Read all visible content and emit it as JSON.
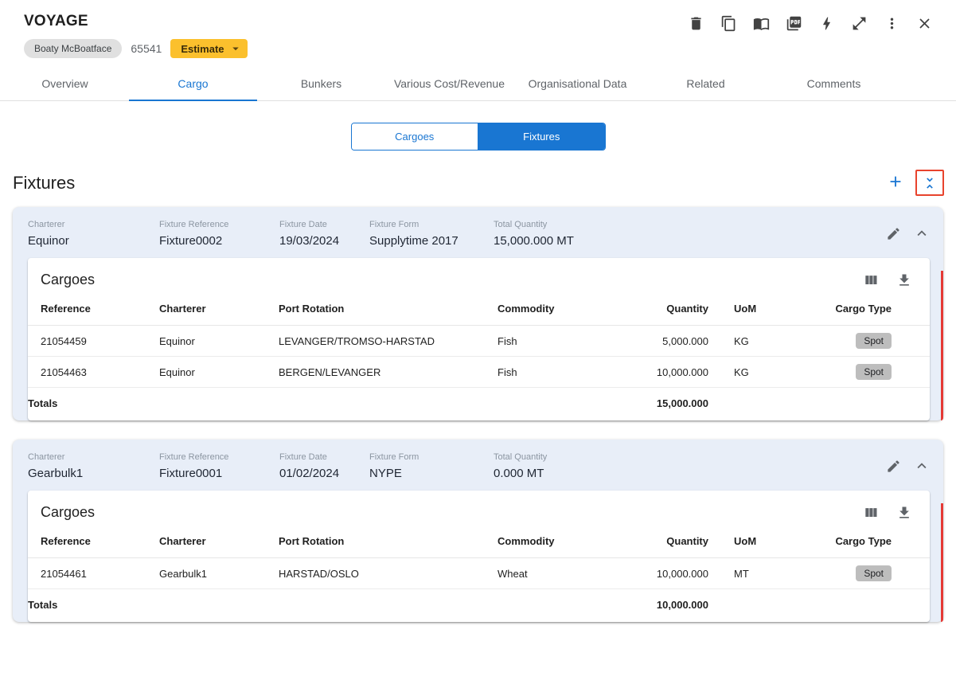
{
  "colors": {
    "primary_blue": "#1976d2",
    "estimate_amber": "#fbc02d",
    "fixture_header_bg": "#e8eef8",
    "red_accent": "#e53935",
    "focus_outline_red": "#e8432d",
    "chip_gray": "#bdbdbd"
  },
  "header": {
    "title": "VOYAGE",
    "vessel_name": "Boaty McBoatface",
    "voyage_number": "65541",
    "estimate_label": "Estimate"
  },
  "toolbar": {
    "icons": [
      "delete-icon",
      "copy-icon",
      "book-icon",
      "pdf-icon",
      "bolt-icon",
      "open-in-full-icon",
      "more-vert-icon",
      "close-icon"
    ]
  },
  "tabs": [
    "Overview",
    "Cargo",
    "Bunkers",
    "Various Cost/Revenue",
    "Organisational Data",
    "Related",
    "Comments"
  ],
  "active_tab": "Cargo",
  "view_toggle": {
    "cargoes": "Cargoes",
    "fixtures": "Fixtures",
    "selected": "Fixtures"
  },
  "fixtures_section": {
    "title": "Fixtures"
  },
  "fixtures": [
    {
      "charterer_label": "Charterer",
      "charterer": "Equinor",
      "reference_label": "Fixture Reference",
      "reference": "Fixture0002",
      "date_label": "Fixture Date",
      "date": "19/03/2024",
      "form_label": "Fixture Form",
      "form": "Supplytime 2017",
      "quantity_label": "Total Quantity",
      "quantity": "15,000.000 MT",
      "cargoes": {
        "title": "Cargoes",
        "columns": [
          "Reference",
          "Charterer",
          "Port Rotation",
          "Commodity",
          "Quantity",
          "UoM",
          "Cargo Type"
        ],
        "rows": [
          {
            "reference": "21054459",
            "charterer": "Equinor",
            "port_rotation": "LEVANGER/TROMSO-HARSTAD",
            "commodity": "Fish",
            "quantity": "5,000.000",
            "uom": "KG",
            "cargo_type": "Spot"
          },
          {
            "reference": "21054463",
            "charterer": "Equinor",
            "port_rotation": "BERGEN/LEVANGER",
            "commodity": "Fish",
            "quantity": "10,000.000",
            "uom": "KG",
            "cargo_type": "Spot"
          }
        ],
        "totals_label": "Totals",
        "totals_quantity": "15,000.000"
      }
    },
    {
      "charterer_label": "Charterer",
      "charterer": "Gearbulk1",
      "reference_label": "Fixture Reference",
      "reference": "Fixture0001",
      "date_label": "Fixture Date",
      "date": "01/02/2024",
      "form_label": "Fixture Form",
      "form": "NYPE",
      "quantity_label": "Total Quantity",
      "quantity": "0.000 MT",
      "cargoes": {
        "title": "Cargoes",
        "columns": [
          "Reference",
          "Charterer",
          "Port Rotation",
          "Commodity",
          "Quantity",
          "UoM",
          "Cargo Type"
        ],
        "rows": [
          {
            "reference": "21054461",
            "charterer": "Gearbulk1",
            "port_rotation": "HARSTAD/OSLO",
            "commodity": "Wheat",
            "quantity": "10,000.000",
            "uom": "MT",
            "cargo_type": "Spot"
          }
        ],
        "totals_label": "Totals",
        "totals_quantity": "10,000.000"
      }
    }
  ]
}
